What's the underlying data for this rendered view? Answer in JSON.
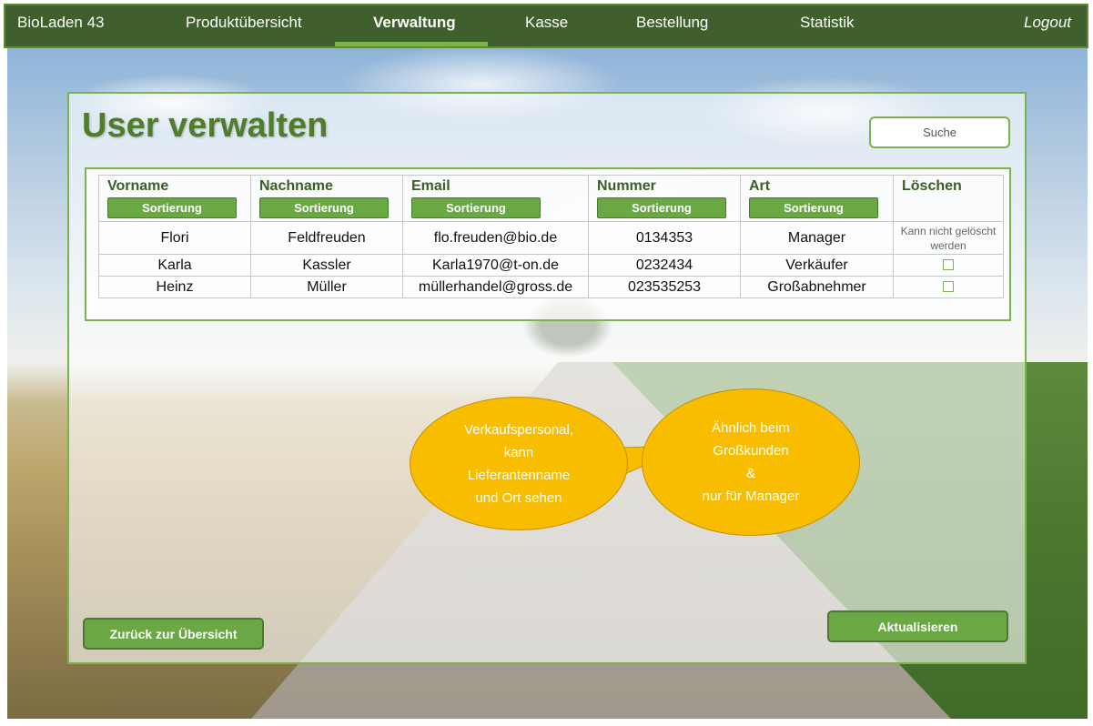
{
  "nav": {
    "brand": "BioLaden 43",
    "items": [
      "Produktübersicht",
      "Verwaltung",
      "Kasse",
      "Bestellung",
      "Statistik"
    ],
    "active": "Verwaltung",
    "logout": "Logout"
  },
  "page": {
    "title": "User verwalten",
    "search_placeholder": "Suche"
  },
  "table": {
    "columns": [
      "Vorname",
      "Nachname",
      "Email",
      "Nummer",
      "Art",
      "Löschen"
    ],
    "sort_label": "Sortierung",
    "rows": [
      {
        "vorname": "Flori",
        "nachname": "Feldfreuden",
        "email": "flo.freuden@bio.de",
        "nummer": "0134353",
        "art": "Manager",
        "loeschen": "Kann nicht gelöscht werden"
      },
      {
        "vorname": "Karla",
        "nachname": "Kassler",
        "email": "Karla1970@t-on.de",
        "nummer": "0232434",
        "art": "Verkäufer",
        "loeschen": ""
      },
      {
        "vorname": "Heinz",
        "nachname": "Müller",
        "email": "müllerhandel@gross.de",
        "nummer": "023535253",
        "art": "Großabnehmer",
        "loeschen": ""
      }
    ]
  },
  "bubbles": {
    "left": [
      "Verkaufspersonal,",
      "kann",
      "Lieferantenname",
      "und Ort sehen"
    ],
    "right": [
      "Ähnlich beim",
      "Großkunden",
      "&",
      "nur für Manager"
    ]
  },
  "buttons": {
    "back": "Zurück zur Übersicht",
    "refresh": "Aktualisieren"
  },
  "colors": {
    "nav_bg": "#3f5f2c",
    "accent_green": "#6aa843",
    "title_green": "#4f7d2b",
    "bubble_yellow": "#f9bd00"
  }
}
